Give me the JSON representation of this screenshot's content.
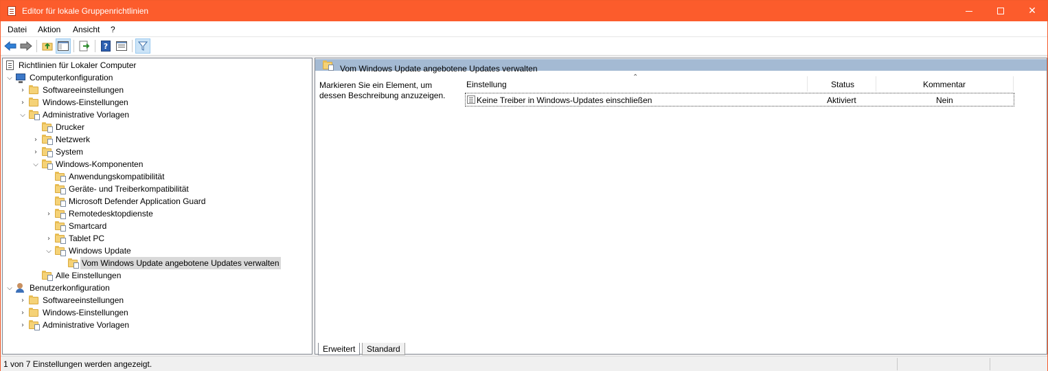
{
  "window": {
    "title": "Editor für lokale Gruppenrichtlinien"
  },
  "menu": [
    "Datei",
    "Aktion",
    "Ansicht",
    "?"
  ],
  "toolbar": {
    "buttons": [
      "back-arrow-icon",
      "forward-arrow-icon",
      "up-folder-icon",
      "show-hide-tree-icon",
      "export-list-icon",
      "help-icon",
      "properties-icon",
      "filter-icon"
    ]
  },
  "tree": {
    "root": "Richtlinien für Lokaler Computer",
    "items": [
      {
        "label": "Computerkonfiguration"
      },
      {
        "label": "Softwareeinstellungen"
      },
      {
        "label": "Windows-Einstellungen"
      },
      {
        "label": "Administrative Vorlagen"
      },
      {
        "label": "Drucker"
      },
      {
        "label": "Netzwerk"
      },
      {
        "label": "System"
      },
      {
        "label": "Windows-Komponenten"
      },
      {
        "label": "Anwendungskompatibilität"
      },
      {
        "label": "Geräte- und Treiberkompatibilität"
      },
      {
        "label": "Microsoft Defender Application Guard"
      },
      {
        "label": "Remotedesktopdienste"
      },
      {
        "label": "Smartcard"
      },
      {
        "label": "Tablet PC"
      },
      {
        "label": "Windows Update"
      },
      {
        "label": "Vom Windows Update angebotene Updates verwalten"
      },
      {
        "label": "Alle Einstellungen"
      },
      {
        "label": "Benutzerkonfiguration"
      },
      {
        "label": "Softwareeinstellungen"
      },
      {
        "label": "Windows-Einstellungen"
      },
      {
        "label": "Administrative Vorlagen"
      }
    ]
  },
  "details": {
    "header_title": "Vom Windows Update angebotene Updates verwalten",
    "description": "Markieren Sie ein Element, um dessen Beschreibung anzuzeigen.",
    "columns": {
      "setting": "Einstellung",
      "status": "Status",
      "comment": "Kommentar"
    },
    "rows": [
      {
        "setting": "Keine Treiber in Windows-Updates einschließen",
        "status": "Aktiviert",
        "comment": "Nein"
      }
    ],
    "tabs": [
      "Erweitert",
      "Standard"
    ]
  },
  "status_bar": {
    "text": "1 von 7 Einstellungen werden angezeigt."
  },
  "colors": {
    "titlebar": "#fc5c2c",
    "header_band": "#a4bad3",
    "selection": "#d9d9d9"
  }
}
